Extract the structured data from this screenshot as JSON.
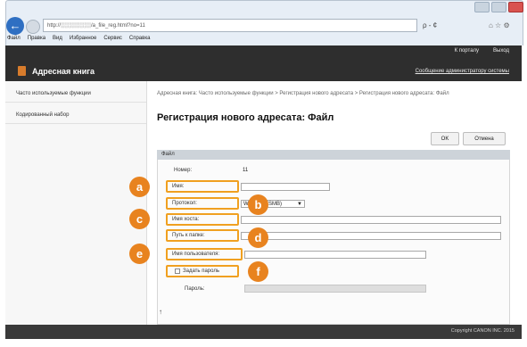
{
  "browser": {
    "url": "http://░░░░░░░░/a_file_reg.html?no=11",
    "address_controls": "ρ - ¢",
    "right_icons": "⌂ ☆ ⚙",
    "menu": [
      "Файл",
      "Правка",
      "Вид",
      "Избранное",
      "Сервис",
      "Справка"
    ]
  },
  "header": {
    "to_portal": "К порталу",
    "logout": "Выход",
    "title": "Адресная книга",
    "admin_message": "Сообщение администратору системы"
  },
  "sidebar": {
    "items": [
      {
        "label": "Часто используемые функции"
      },
      {
        "label": "Кодированный набор"
      }
    ]
  },
  "main": {
    "breadcrumb": "Адресная книга: Часто используемые функции > Регистрация нового адресата > Регистрация нового адресата: Файл",
    "title": "Регистрация нового адресата: Файл",
    "ok_label": "OK",
    "cancel_label": "Отмена",
    "section_label": "Файл"
  },
  "form": {
    "number_label": "Номер:",
    "number_value": "11",
    "name_label": "Имя:",
    "name_value": "",
    "protocol_label": "Протокол:",
    "protocol_value": "Windows (SMB)",
    "host_label": "Имя хоста:",
    "host_value": "",
    "path_label": "Путь к папке:",
    "path_value": "",
    "username_label": "Имя пользователя:",
    "username_value": "",
    "set_password_label": "Задать пароль",
    "set_password_checked": false,
    "password_label": "Пароль:",
    "password_value": ""
  },
  "callouts": {
    "a": "a",
    "b": "b",
    "c": "c",
    "d": "d",
    "e": "e",
    "f": "f"
  },
  "footer": {
    "copyright": "Copyright CANON INC. 2015"
  },
  "colors": {
    "accent": "#e8831f",
    "header_bg": "#2e2e2e",
    "section_bar": "#cdd3d9"
  }
}
